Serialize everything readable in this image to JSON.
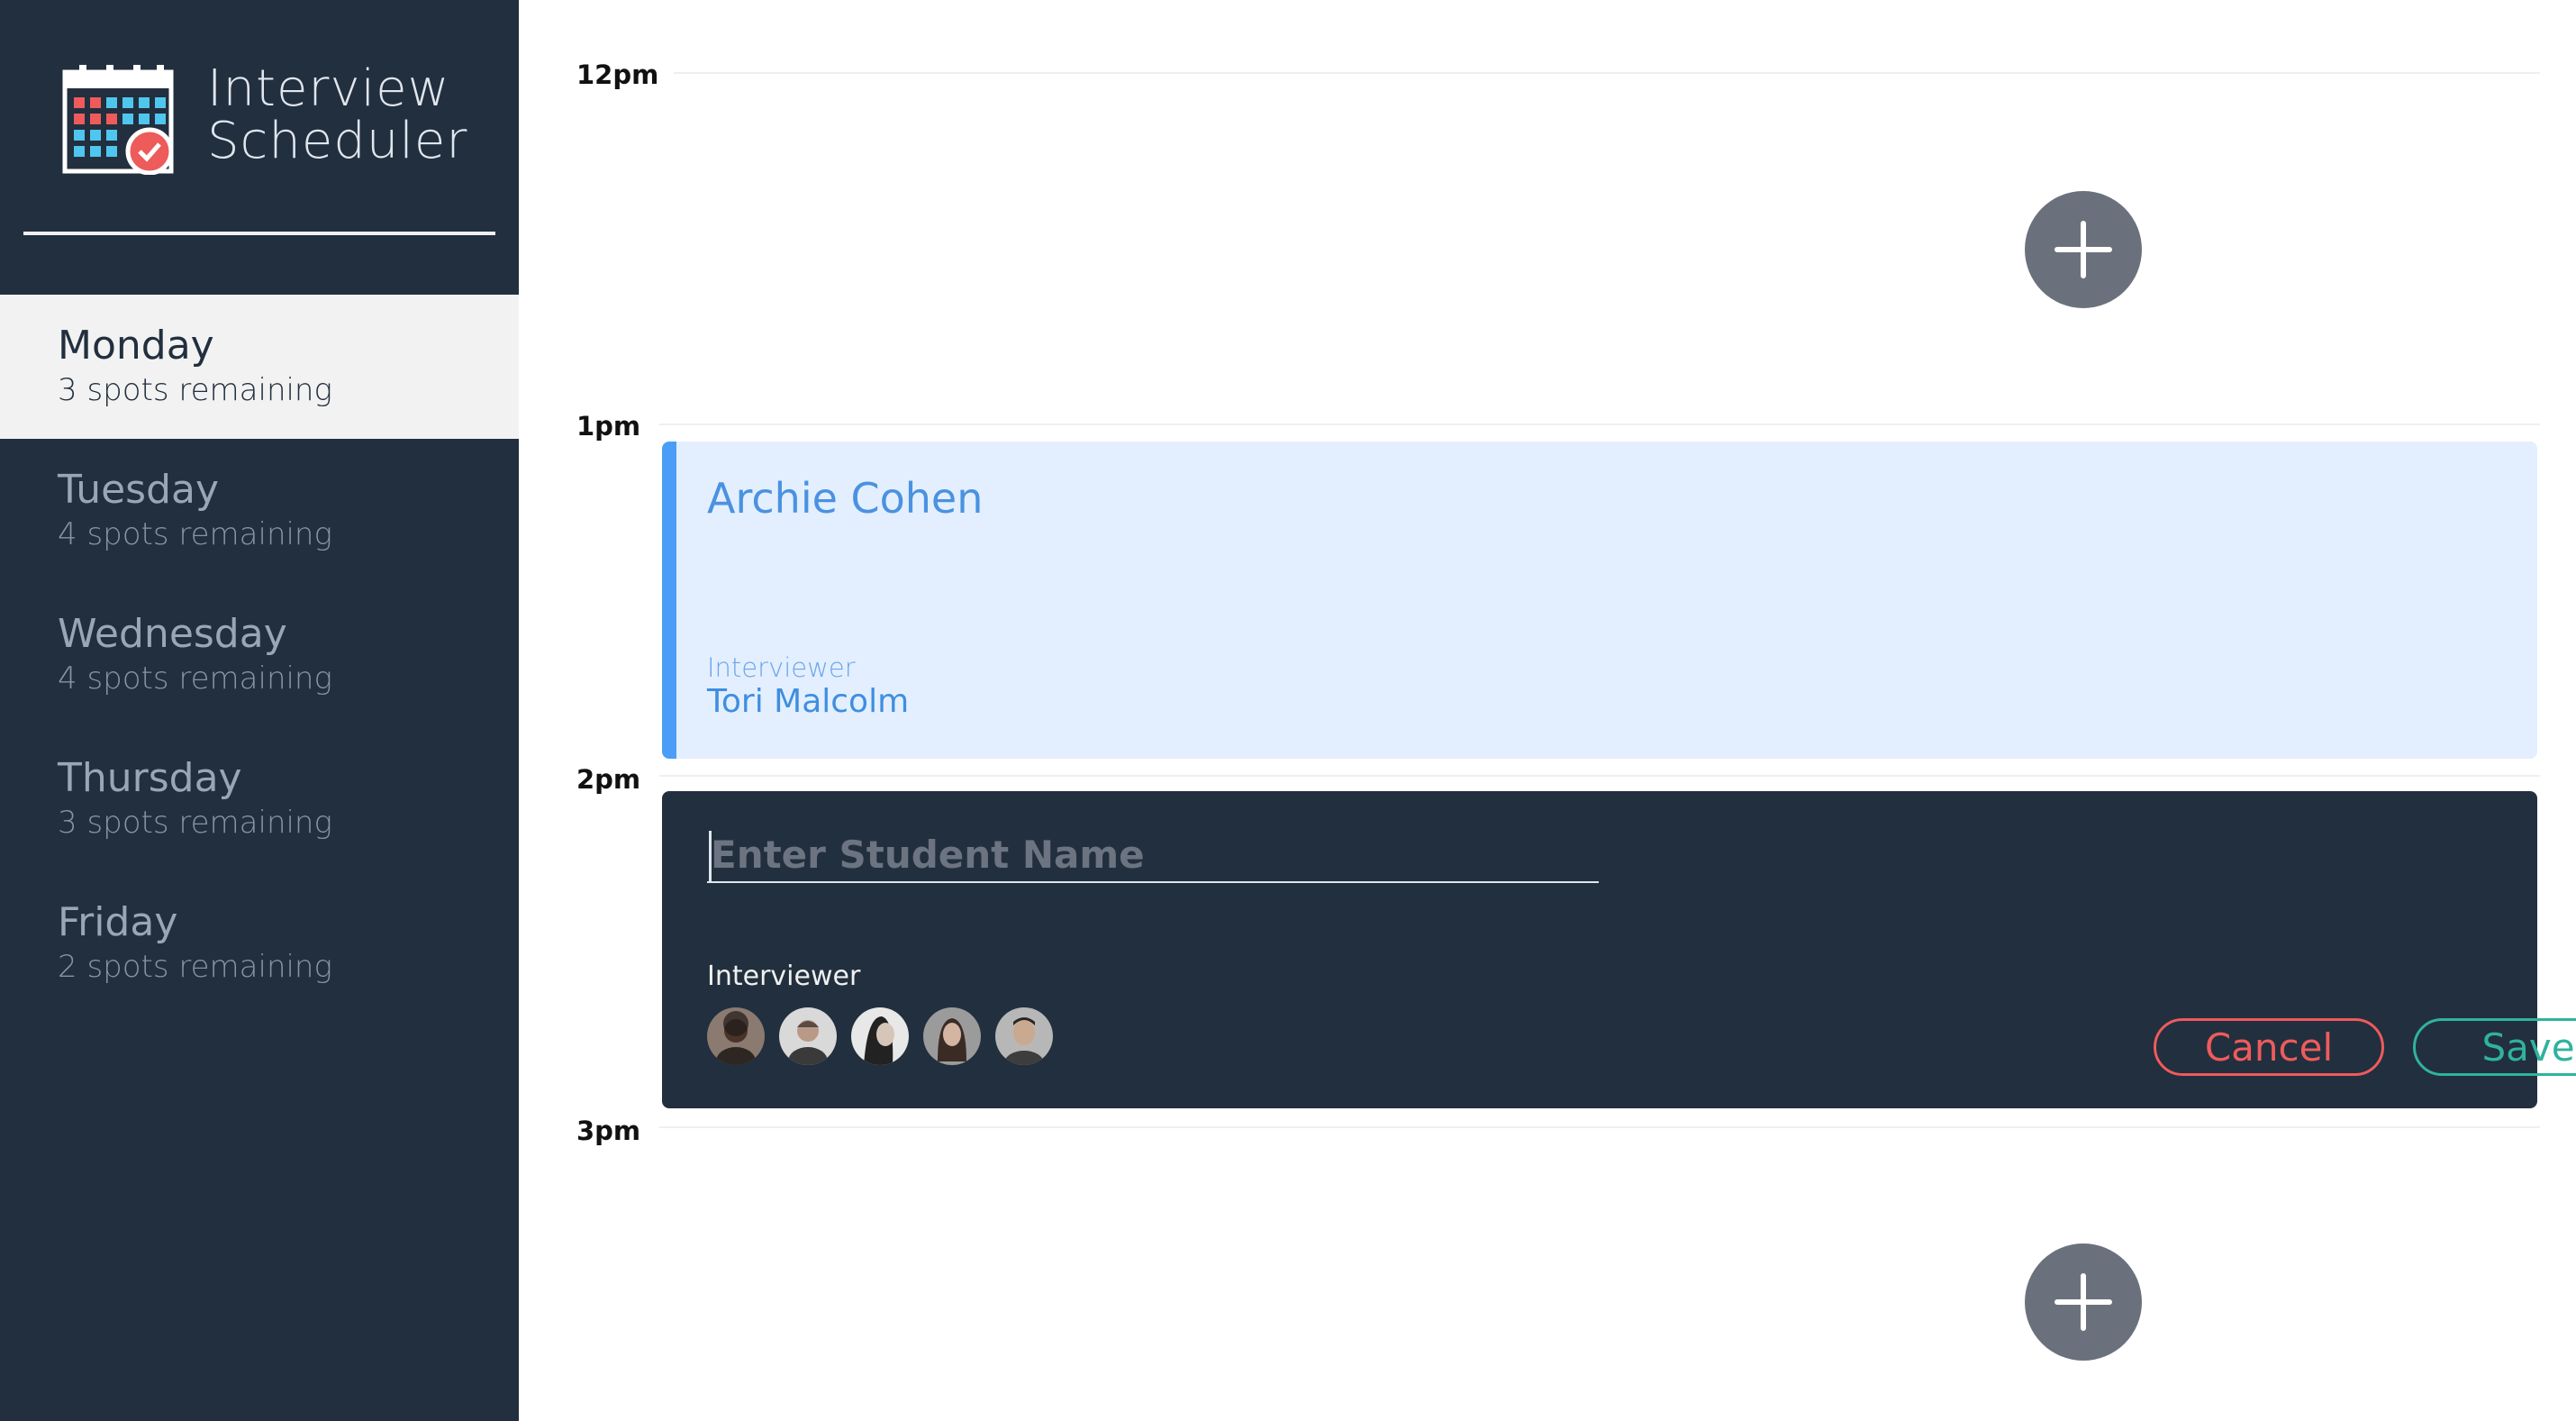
{
  "app": {
    "title_line1": "Interview",
    "title_line2": "Scheduler",
    "logo_icon": "calendar-check-icon"
  },
  "days": [
    {
      "name": "Monday",
      "spots": "3 spots remaining",
      "selected": true
    },
    {
      "name": "Tuesday",
      "spots": "4 spots remaining",
      "selected": false
    },
    {
      "name": "Wednesday",
      "spots": "4 spots remaining",
      "selected": false
    },
    {
      "name": "Thursday",
      "spots": "3 spots remaining",
      "selected": false
    },
    {
      "name": "Friday",
      "spots": "2 spots remaining",
      "selected": false
    }
  ],
  "times": [
    "12pm",
    "1pm",
    "2pm",
    "3pm"
  ],
  "appointment": {
    "student": "Archie Cohen",
    "interviewer_label": "Interviewer",
    "interviewer_name": "Tori Malcolm"
  },
  "form": {
    "placeholder": "Enter Student Name",
    "interviewer_label": "Interviewer",
    "cancel_label": "Cancel",
    "save_label": "Save",
    "avatar_count": 5
  },
  "colors": {
    "sidebar_bg": "#222f3e",
    "appointment_bg": "#e3efff",
    "appointment_accent": "#4b9ef5",
    "cancel": "#ee5b5b",
    "save": "#2fb39c",
    "add_button": "#6b717c"
  }
}
